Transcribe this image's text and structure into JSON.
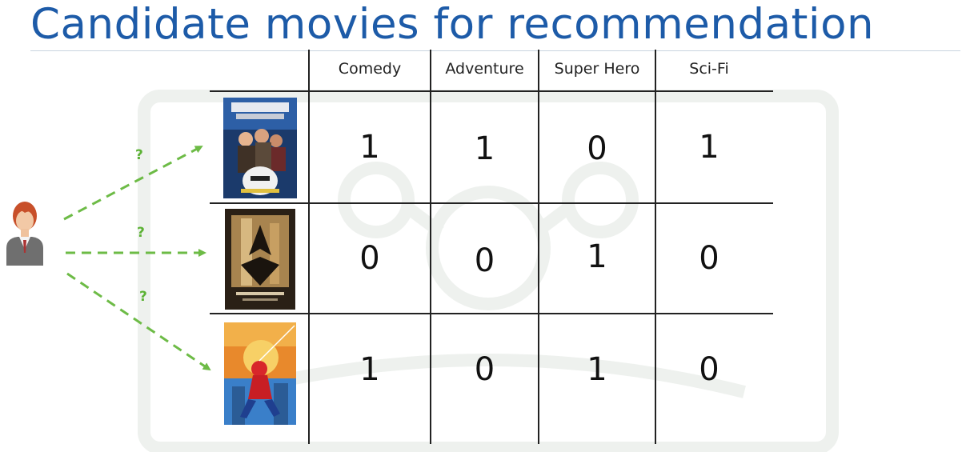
{
  "title": "Candidate movies for recommendation",
  "colors": {
    "title": "#1d5ba8",
    "arrow": "#6dbb46",
    "grid": "#222222"
  },
  "user": {
    "icon": "user-avatar-icon"
  },
  "arrows": {
    "labels": [
      "?",
      "?",
      "?"
    ]
  },
  "table": {
    "columns": [
      "Comedy",
      "Adventure",
      "Super Hero",
      "Sci-Fi"
    ],
    "rows": [
      {
        "poster": "hitchhikers-guide-poster",
        "values": [
          "1",
          "1",
          "0",
          "1"
        ]
      },
      {
        "poster": "batman-begins-poster",
        "values": [
          "0",
          "0",
          "1",
          "0"
        ]
      },
      {
        "poster": "spider-man-poster",
        "values": [
          "1",
          "0",
          "1",
          "0"
        ]
      }
    ]
  }
}
